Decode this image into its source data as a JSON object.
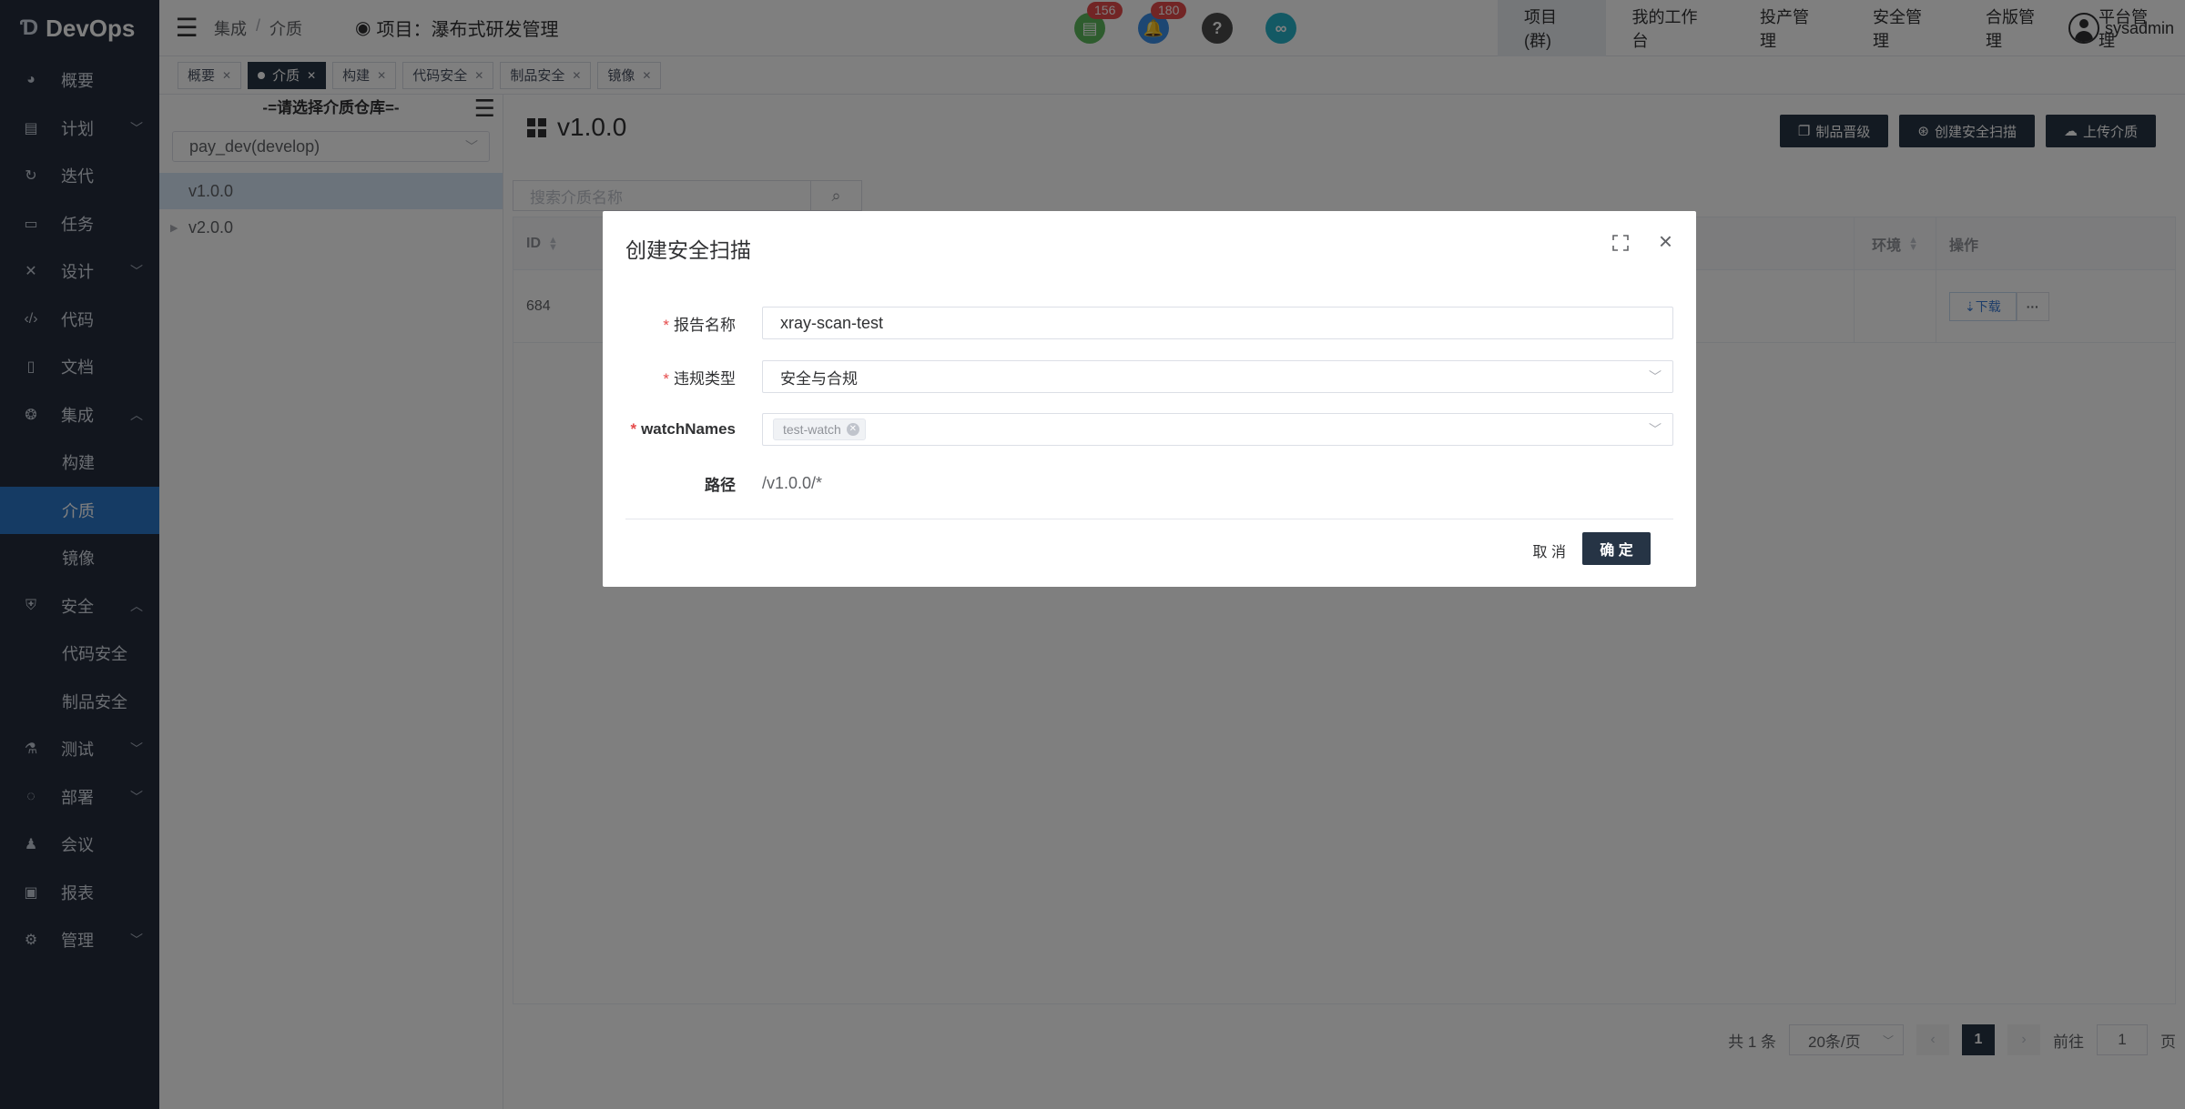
{
  "app": {
    "logo": "DevOps"
  },
  "sidebar": {
    "items": [
      {
        "label": "概要",
        "icon": "dashboard-icon"
      },
      {
        "label": "计划",
        "icon": "plan-icon"
      },
      {
        "label": "迭代",
        "icon": "iteration-icon"
      },
      {
        "label": "任务",
        "icon": "task-icon"
      },
      {
        "label": "设计",
        "icon": "design-icon"
      },
      {
        "label": "代码",
        "icon": "code-icon"
      },
      {
        "label": "文档",
        "icon": "doc-icon"
      },
      {
        "label": "集成",
        "icon": "integration-icon"
      },
      {
        "label": "构建"
      },
      {
        "label": "介质"
      },
      {
        "label": "镜像"
      },
      {
        "label": "安全",
        "icon": "shield-icon"
      },
      {
        "label": "代码安全"
      },
      {
        "label": "制品安全"
      },
      {
        "label": "测试",
        "icon": "flask-icon"
      },
      {
        "label": "部署",
        "icon": "deploy-icon"
      },
      {
        "label": "会议",
        "icon": "meeting-icon"
      },
      {
        "label": "报表",
        "icon": "report-icon"
      },
      {
        "label": "管理",
        "icon": "gear-icon"
      }
    ]
  },
  "header": {
    "breadcrumb": [
      "集成",
      "/",
      "介质"
    ],
    "project": "项目：瀑布式研发管理",
    "badge_doc": "156",
    "badge_bell": "180",
    "nav": [
      "项目(群)",
      "我的工作台",
      "投产管理",
      "安全管理",
      "合版管理",
      "平台管理"
    ],
    "user": "sysadmin"
  },
  "tabs": [
    {
      "label": "概要"
    },
    {
      "label": "介质"
    },
    {
      "label": "构建"
    },
    {
      "label": "代码安全"
    },
    {
      "label": "制品安全"
    },
    {
      "label": "镜像"
    }
  ],
  "left": {
    "title": "-=请选择介质仓库=-",
    "repo": "pay_dev(develop)",
    "tree": [
      "v1.0.0",
      "v2.0.0"
    ]
  },
  "main": {
    "title": "v1.0.0",
    "buttons": [
      "制品晋级",
      "创建安全扫描",
      "上传介质"
    ],
    "search_placeholder": "搜索介质名称",
    "columns": [
      "ID",
      "环境",
      "操作"
    ],
    "rows": [
      {
        "id": "684",
        "download": "下载",
        "more": "···"
      }
    ],
    "pager": {
      "total": "共 1 条",
      "size": "20条/页",
      "page": "1",
      "goto": "前往",
      "goto_value": "1",
      "page_unit": "页"
    }
  },
  "dialog": {
    "title": "创建安全扫描",
    "report_name_label": "报告名称",
    "report_name_value": "xray-scan-test",
    "violation_label": "违规类型",
    "violation_value": "安全与合规",
    "watch_label": "watchNames",
    "watch_tag": "test-watch",
    "path_label": "路径",
    "path_value": "/v1.0.0/*",
    "cancel": "取 消",
    "ok": "确 定"
  }
}
